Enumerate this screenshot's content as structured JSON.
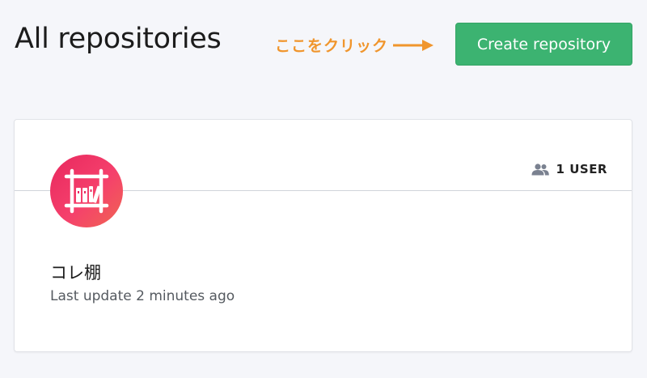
{
  "header": {
    "title": "All repositories",
    "create_button_label": "Create repository"
  },
  "annotation": {
    "text": "ここをクリック",
    "color": "#f0952c"
  },
  "repositories": [
    {
      "name": "コレ棚",
      "last_update": "Last update 2 minutes ago",
      "user_count": "1 USER",
      "avatar_icon": "bookshelf-icon"
    }
  ],
  "colors": {
    "primary_button": "#3cb371",
    "page_background": "#f5f6fa",
    "avatar_gradient_start": "#e8285e",
    "avatar_gradient_end": "#f06552"
  }
}
